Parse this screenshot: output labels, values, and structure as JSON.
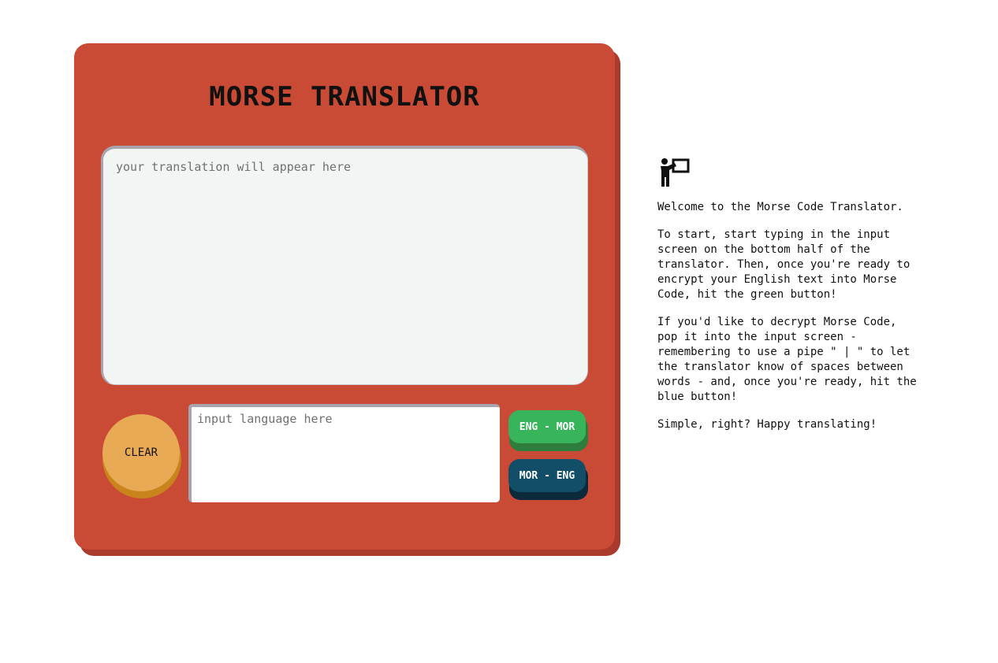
{
  "app": {
    "title": "MORSE TRANSLATOR"
  },
  "output": {
    "placeholder": "your translation will appear here"
  },
  "controls": {
    "clear_label": "CLEAR",
    "input_placeholder": "input language here",
    "eng_to_mor_label": "ENG - MOR",
    "mor_to_eng_label": "MOR - ENG"
  },
  "info": {
    "icon": "teacher-icon",
    "paragraphs": [
      "Welcome to the Morse Code Translator.",
      "To start, start typing in the input\nscreen on the bottom half of the\ntranslator. Then, once you're ready to\nencrypt your English text into Morse\nCode, hit the green button!",
      "If you'd like to decrypt Morse Code,\npop it into the input screen -\nremembering to use a pipe \" | \" to let\nthe translator know of spaces between\nwords - and, once you're ready, hit the\nblue button!",
      "Simple, right? Happy translating!"
    ]
  },
  "colors": {
    "device": "#c94a35",
    "screen": "#f1f6f4",
    "clear_button": "#e8aa55",
    "eng_button": "#38b45a",
    "mor_button": "#134e69"
  }
}
